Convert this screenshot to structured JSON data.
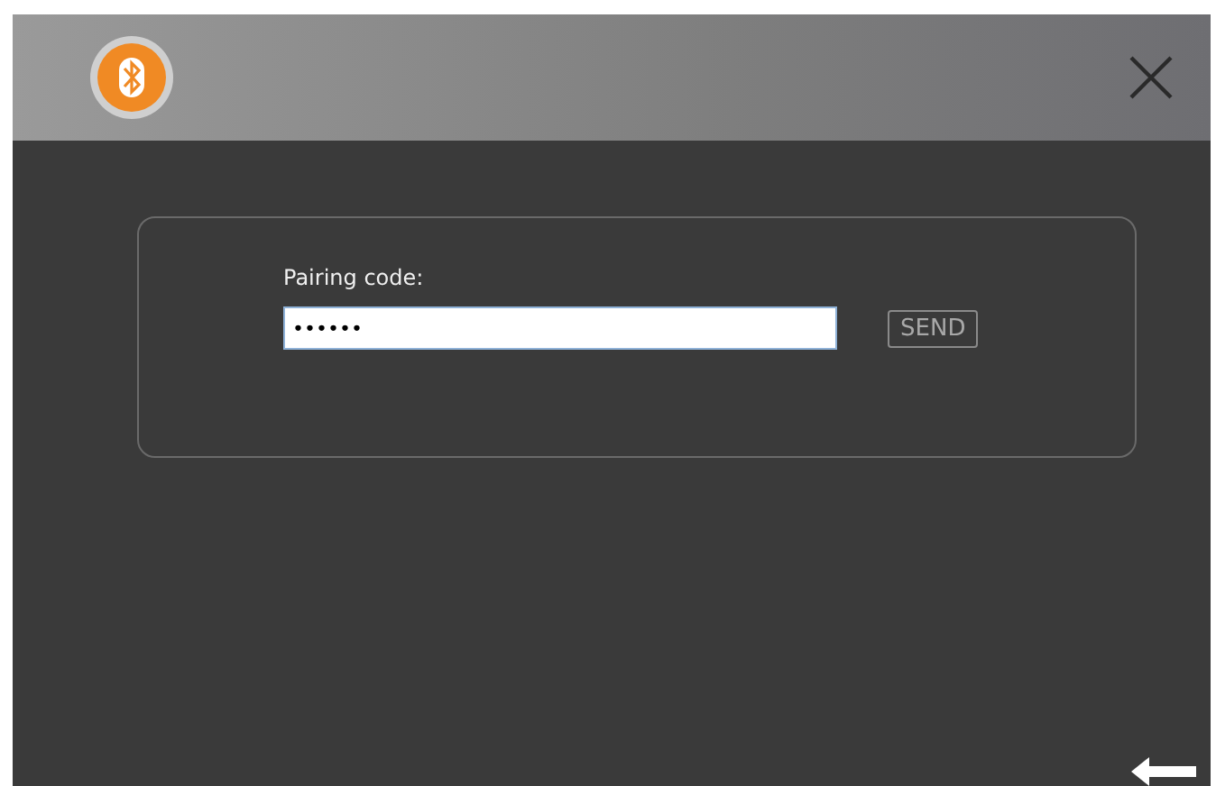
{
  "dialog": {
    "label": "Pairing code:",
    "value": "••••••",
    "button": "SEND"
  }
}
